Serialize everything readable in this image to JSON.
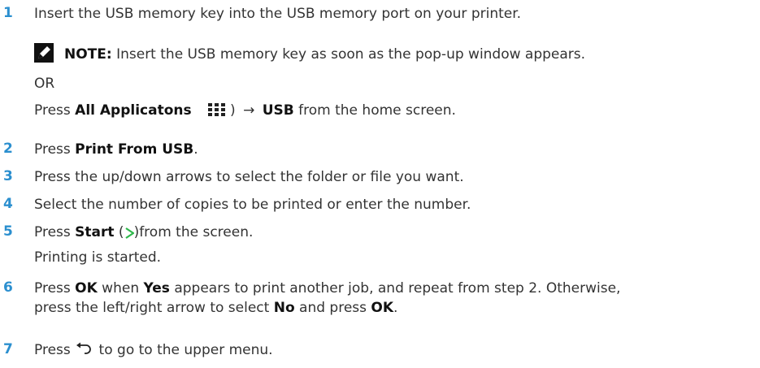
{
  "steps": [
    {
      "num": "1",
      "text": "Insert the USB memory key into the USB memory port on your printer.",
      "note_label": "NOTE:",
      "note_text": " Insert the USB memory key as soon as the pop-up window appears.",
      "or_text": "OR",
      "press": "Press ",
      "all_apps": "All Applicatons",
      "paren_close": ")",
      "arrow": "→",
      "usb": "USB",
      "home": " from the home screen."
    },
    {
      "num": "2",
      "press": "Press ",
      "print_from_usb": "Print From USB",
      "period": "."
    },
    {
      "num": "3",
      "text": "Press the up/down arrows to select the folder or file you want."
    },
    {
      "num": "4",
      "text": "Select the number of copies to be printed or enter the number."
    },
    {
      "num": "5",
      "press": "Press ",
      "start": "Start",
      "open_paren": " (",
      "after": ")from the screen.",
      "followup": "Printing is started."
    },
    {
      "num": "6",
      "press": "Press ",
      "ok": "OK",
      "when": " when ",
      "yes": "Yes",
      "rest": " appears to print another job, and repeat from step 2. Otherwise,",
      "line2a": "press the left/right arrow to select ",
      "no": "No",
      "line2b": " and press ",
      "ok2": "OK",
      "period": "."
    },
    {
      "num": "7",
      "press": "Press ",
      "rest": " to go to the upper menu."
    }
  ],
  "colors": {
    "step_number": "#2b8fcf",
    "body_text": "#333333",
    "start_icon": "#2eb84b",
    "note_icon": "#111111"
  },
  "icons": {
    "note": "pencil-note-icon",
    "apps": "all-applications-grid-icon",
    "start": "start-play-icon",
    "back": "back-arrow-icon"
  }
}
